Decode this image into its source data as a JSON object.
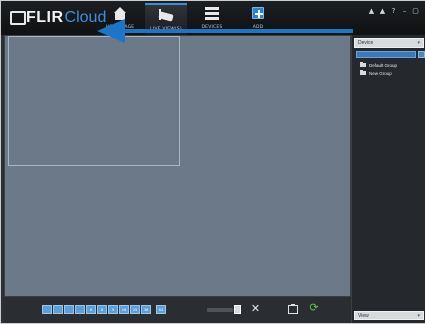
{
  "app": {
    "brand": "FLIR",
    "brand_suffix": "Cloud"
  },
  "nav": {
    "items": [
      {
        "label": "HOME PAGE",
        "icon": "home-icon"
      },
      {
        "label": "LIVE VIEW(S)",
        "icon": "camera-icon",
        "active": true
      },
      {
        "label": "DEVICES",
        "icon": "devices-icon"
      },
      {
        "label": "ADD",
        "icon": "add-icon"
      }
    ]
  },
  "window_controls": {
    "user": "▲",
    "lock": "▲",
    "help": "?",
    "minimize": "–",
    "close": "▢"
  },
  "toolbar": {
    "layouts": [
      "",
      "",
      "",
      "",
      "6",
      "8",
      "9",
      "16",
      "25",
      "36",
      "64"
    ],
    "close_symbol": "✕",
    "refresh_symbol": "⟳"
  },
  "right_panel": {
    "device_header": "Device",
    "search_placeholder": "Input keyword to filtering",
    "tree": [
      {
        "label": "Default Group"
      },
      {
        "label": "New Group"
      }
    ],
    "view_header": "View",
    "caret": "▾"
  },
  "colors": {
    "accent": "#3d8fd8",
    "arrow": "#1b75c8",
    "view_bg": "#6c7989",
    "frame_bg": "#2b3035"
  }
}
